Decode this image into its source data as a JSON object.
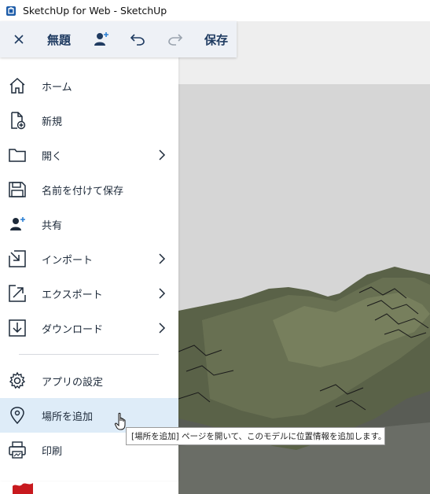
{
  "window": {
    "title": "SketchUp for Web - SketchUp"
  },
  "toolbar": {
    "doc_title": "無題",
    "save_label": "保存"
  },
  "menu": {
    "items": [
      {
        "label": "ホーム",
        "icon": "home-icon",
        "submenu": false
      },
      {
        "label": "新規",
        "icon": "new-file-icon",
        "submenu": false
      },
      {
        "label": "開く",
        "icon": "folder-icon",
        "submenu": true
      },
      {
        "label": "名前を付けて保存",
        "icon": "save-disk-icon",
        "submenu": false
      },
      {
        "label": "共有",
        "icon": "share-user-icon",
        "submenu": false
      },
      {
        "label": "インポート",
        "icon": "import-icon",
        "submenu": true
      },
      {
        "label": "エクスポート",
        "icon": "export-icon",
        "submenu": true
      },
      {
        "label": "ダウンロード",
        "icon": "download-icon",
        "submenu": true
      },
      {
        "label": "アプリの設定",
        "icon": "gear-icon",
        "submenu": false
      },
      {
        "label": "場所を追加",
        "icon": "location-pin-icon",
        "submenu": false,
        "hovered": true
      },
      {
        "label": "印刷",
        "icon": "printer-icon",
        "submenu": false
      }
    ]
  },
  "tooltip": {
    "text": "[場所を追加] ページを開いて、このモデルに位置情報を追加します。"
  },
  "colors": {
    "accent": "#1f3b61",
    "hover": "#deecf8",
    "toolbar_bg": "#eef1f6"
  }
}
